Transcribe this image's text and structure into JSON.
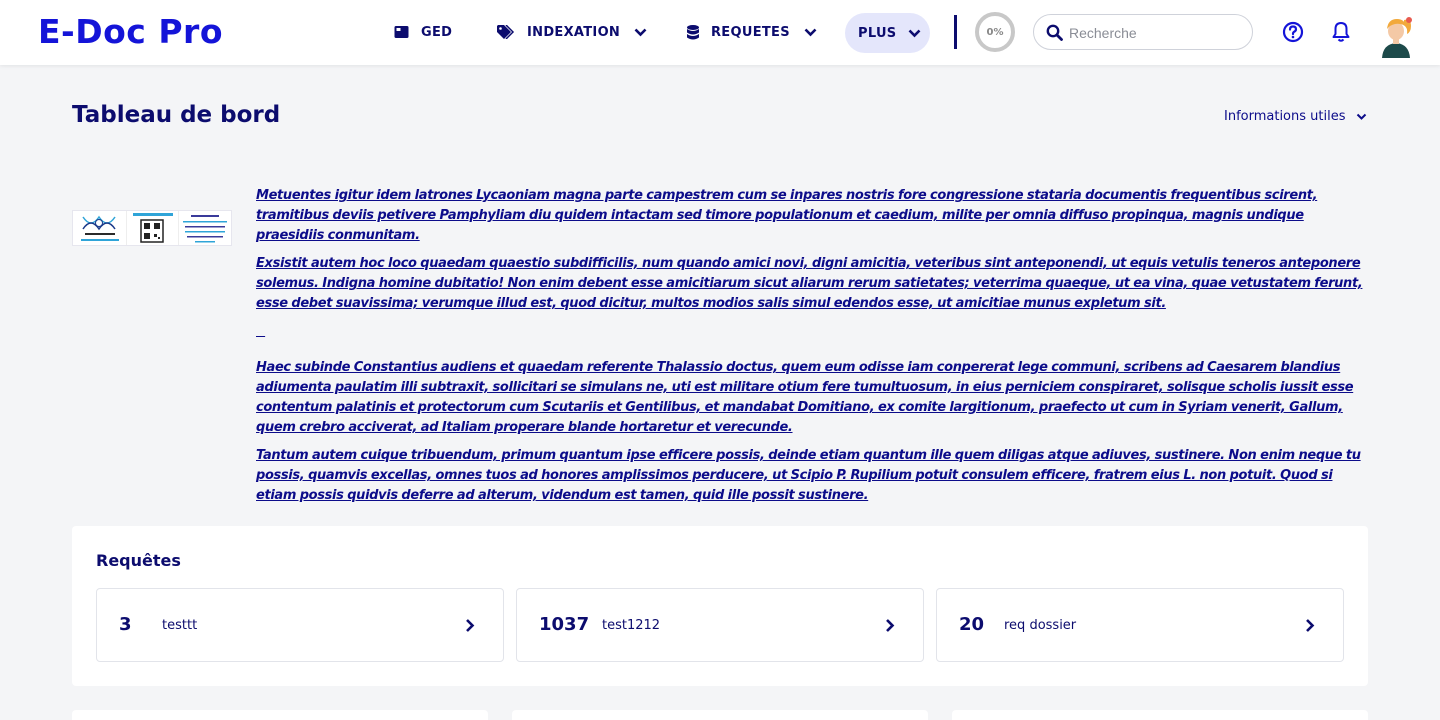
{
  "app": {
    "logo": "E-Doc Pro"
  },
  "nav": {
    "ged": "GED",
    "indexation": "INDEXATION",
    "requetes": "REQUETES",
    "plus": "PLUS"
  },
  "progress": "0%",
  "search": {
    "placeholder": "Recherche"
  },
  "page": {
    "title": "Tableau de bord",
    "info_toggle": "Informations utiles"
  },
  "info": {
    "paragraphs": [
      "Metuentes igitur idem latrones Lycaoniam magna parte campestrem cum se inpares nostris fore congressione stataria documentis frequentibus scirent, tramitibus deviis petivere Pamphyliam diu quidem intactam sed timore populationum et caedium, milite per omnia diffuso propinqua, magnis undique praesidiis conmunitam.",
      "Exsistit autem hoc loco quaedam quaestio subdifficilis, num quando amici novi, digni amicitia, veteribus sint anteponendi, ut equis vetulis teneros anteponere solemus. Indigna homine dubitatio! Non enim debent esse amicitiarum sicut aliarum rerum satietates; veterrima quaeque, ut ea vina, quae vetustatem ferunt, esse debet suavissima; verumque illud est, quod dicitur, multos modios salis simul edendos esse, ut amicitiae munus expletum sit.",
      "Haec subinde Constantius audiens et quaedam referente Thalassio doctus, quem eum odisse iam conpererat lege communi, scribens ad Caesarem blandius adiumenta paulatim illi subtraxit, sollicitari se simulans ne, uti est militare otium fere tumultuosum, in eius perniciem conspiraret, solisque scholis iussit esse contentum palatinis et protectorum cum Scutariis et Gentilibus, et mandabat Domitiano, ex comite largitionum, praefecto ut cum in Syriam venerit, Gallum, quem crebro acciverat, ad Italiam properare blande hortaretur et verecunde.",
      "Tantum autem cuique tribuendum, primum quantum ipse efficere possis, deinde etiam quantum ille quem diligas atque adiuves, sustinere. Non enim neque tu possis, quamvis excellas, omnes tuos ad honores amplissimos perducere, ut Scipio P. Rupilium potuit consulem efficere, fratrem eius L. non potuit. Quod si etiam possis quidvis deferre ad alterum, videndum est tamen, quid ille possit sustinere."
    ]
  },
  "requetes": {
    "title": "Requêtes",
    "items": [
      {
        "count": "3",
        "label": "testtt"
      },
      {
        "count": "1037",
        "label": "test1212"
      },
      {
        "count": "20",
        "label": "req dossier"
      }
    ]
  },
  "colors": {
    "brand": "#1414d8",
    "navy": "#0c0c6e",
    "link": "#0c0c8a",
    "plus_bg": "#e4e6fb",
    "page_bg": "#f4f5f7"
  },
  "icons": [
    "folder-icon",
    "tag-icon",
    "database-icon",
    "chevron-down-icon",
    "search-icon",
    "help-icon",
    "bell-icon",
    "chevron-right-icon"
  ]
}
